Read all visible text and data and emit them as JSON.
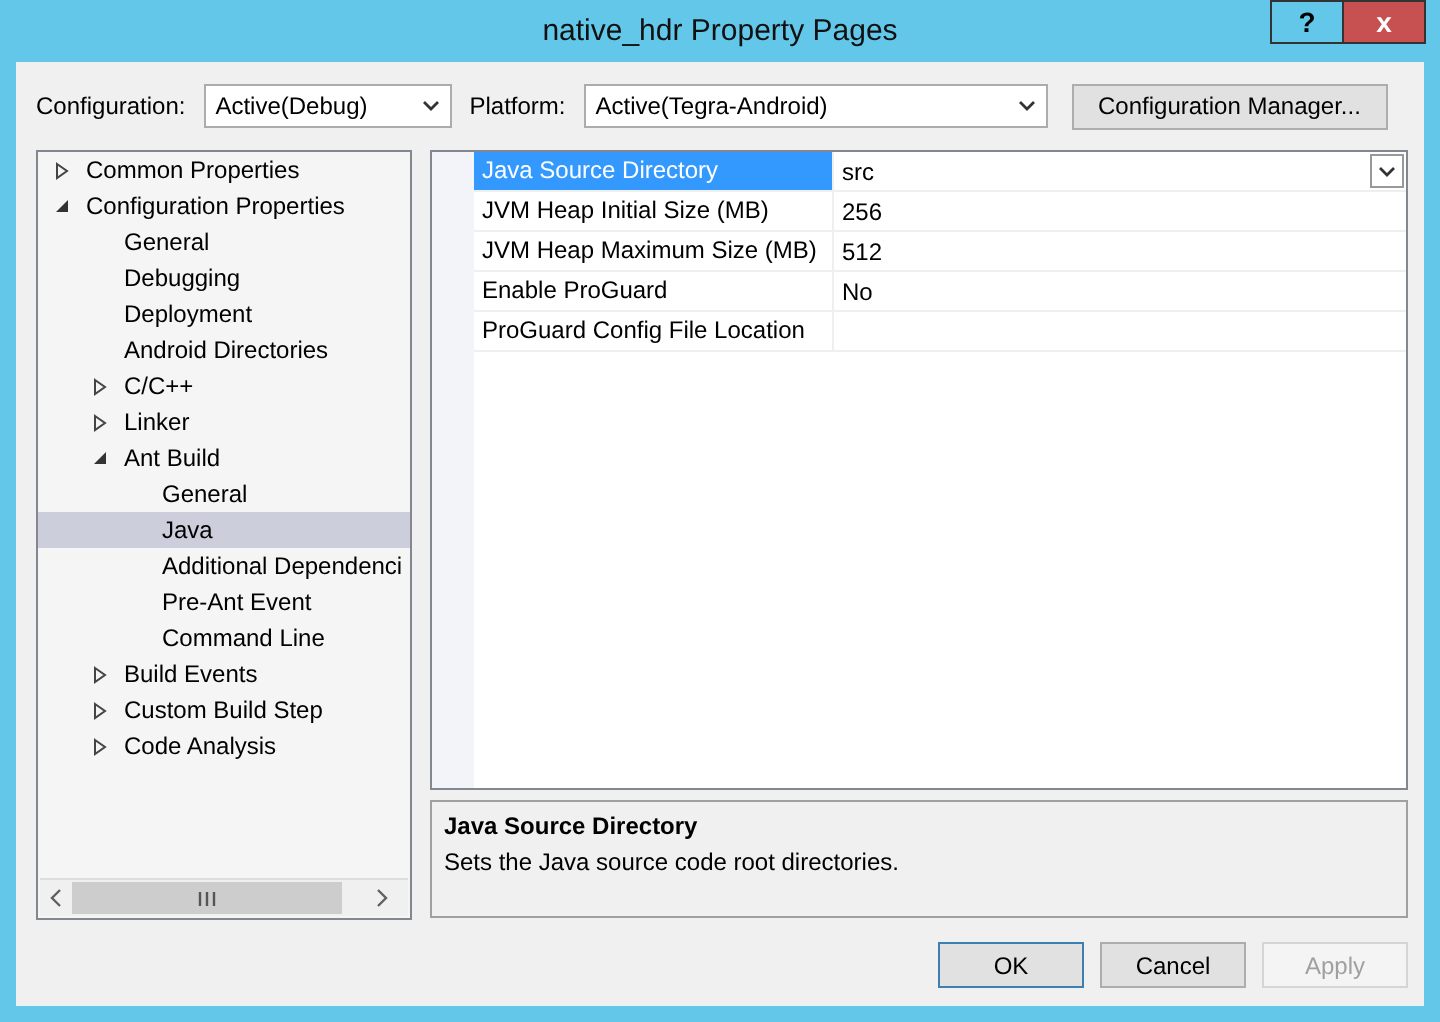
{
  "window": {
    "title": "native_hdr Property Pages",
    "help": "?",
    "close": "x"
  },
  "toolbar": {
    "configuration_label": "Configuration:",
    "configuration_value": "Active(Debug)",
    "platform_label": "Platform:",
    "platform_value": "Active(Tegra-Android)",
    "manager_button": "Configuration Manager..."
  },
  "tree": [
    {
      "label": "Common Properties",
      "expanded": false,
      "selected": false
    },
    {
      "label": "Configuration Properties",
      "expanded": true,
      "selected": false,
      "children": [
        {
          "label": "General",
          "selected": false
        },
        {
          "label": "Debugging",
          "selected": false
        },
        {
          "label": "Deployment",
          "selected": false
        },
        {
          "label": "Android Directories",
          "selected": false
        },
        {
          "label": "C/C++",
          "expanded": false,
          "selected": false
        },
        {
          "label": "Linker",
          "expanded": false,
          "selected": false
        },
        {
          "label": "Ant Build",
          "expanded": true,
          "selected": false,
          "children": [
            {
              "label": "General",
              "selected": false
            },
            {
              "label": "Java",
              "selected": true
            },
            {
              "label": "Additional Dependenci",
              "selected": false
            },
            {
              "label": "Pre-Ant Event",
              "selected": false
            },
            {
              "label": "Command Line",
              "selected": false
            }
          ]
        },
        {
          "label": "Build Events",
          "expanded": false,
          "selected": false
        },
        {
          "label": "Custom Build Step",
          "expanded": false,
          "selected": false
        },
        {
          "label": "Code Analysis",
          "expanded": false,
          "selected": false
        }
      ]
    }
  ],
  "properties": [
    {
      "name": "Java Source Directory",
      "value": "src",
      "selected": true
    },
    {
      "name": "JVM Heap Initial Size (MB)",
      "value": "256",
      "selected": false
    },
    {
      "name": "JVM Heap Maximum Size (MB)",
      "value": "512",
      "selected": false
    },
    {
      "name": "Enable ProGuard",
      "value": "No",
      "selected": false
    },
    {
      "name": "ProGuard Config File Location",
      "selected": false
    }
  ],
  "description": {
    "title": "Java Source Directory",
    "text": "Sets the Java source code root directories."
  },
  "buttons": [
    {
      "label": "OK",
      "disabled": false,
      "default": true
    },
    {
      "label": "Cancel",
      "disabled": false,
      "default": false
    },
    {
      "label": "Apply",
      "disabled": true,
      "default": false
    }
  ]
}
